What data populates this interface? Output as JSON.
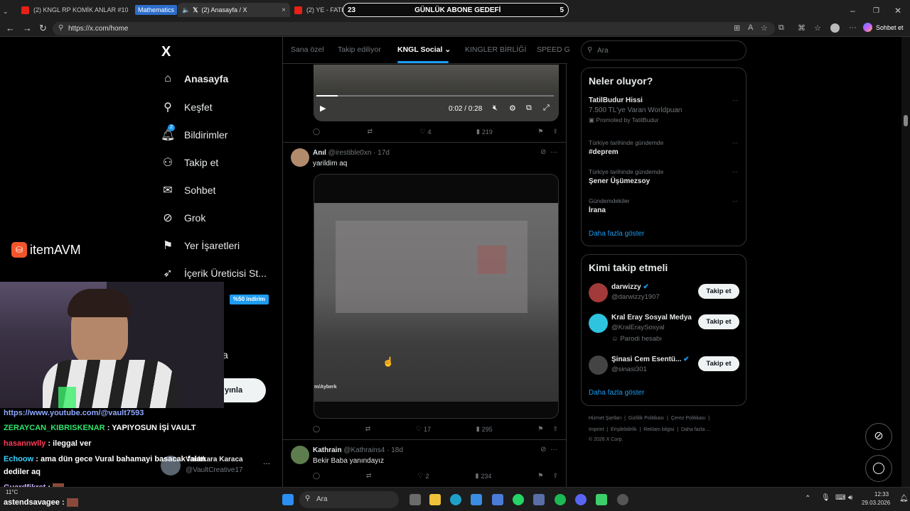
{
  "browser": {
    "tabs": [
      {
        "label": "(2) KNGL RP KOMİK ANLAR #10 -",
        "close": "×"
      },
      {
        "label": "Mathematics"
      },
      {
        "label": "(2) Anasayfa / X",
        "close": "×"
      },
      {
        "label": "(2) YE - FATHER"
      }
    ],
    "url": "https://x.com/home",
    "copilot_label": "Sohbet et"
  },
  "overlay_banner": {
    "left_count": "23",
    "title": "GÜNLÜK ABONE GEDEFİ",
    "right_count": "5"
  },
  "sidebar": {
    "logo": "X",
    "items": [
      {
        "label": "Anasayfa",
        "icon": "home-icon"
      },
      {
        "label": "Keşfet",
        "icon": "search-icon"
      },
      {
        "label": "Bildirimler",
        "icon": "bell-icon",
        "badge": "2"
      },
      {
        "label": "Takip et",
        "icon": "add-user-icon"
      },
      {
        "label": "Sohbet",
        "icon": "mail-icon"
      },
      {
        "label": "Grok",
        "icon": "grok-icon"
      },
      {
        "label": "Yer İşaretleri",
        "icon": "bookmark-icon"
      },
      {
        "label": "İçerik Üreticisi St...",
        "icon": "rocket-icon"
      }
    ],
    "premium_badge": "%50 indirim",
    "partial_more": "a",
    "post_button": "yınla",
    "account": {
      "name": "Vaultkara Karaca",
      "handle": "@VaultCreative17"
    }
  },
  "itemavm": {
    "brand": "itemAVM"
  },
  "feed": {
    "tabs": [
      "Sana özel",
      "Takip ediliyor",
      "KNGL Social",
      "KINGLER BİRLİĞİ",
      "SPEED G"
    ],
    "video_time": "0:02 / 0:28",
    "post0_actions": {
      "replies": "",
      "reposts": "",
      "likes": "4",
      "views": "219"
    },
    "posts": [
      {
        "name": "Anıl",
        "handle": "@irestible0xn",
        "time": "17d",
        "text": "yarildim aq",
        "watermark": "m/Ayberk",
        "likes": "17",
        "views": "295"
      },
      {
        "name": "Kathrain",
        "handle": "@Kathrains4",
        "time": "18d",
        "text": "Bekir Baba yanındayız",
        "likes": "2",
        "views": "234"
      }
    ]
  },
  "right": {
    "search_placeholder": "Ara",
    "trends_title": "Neler oluyor?",
    "trends": [
      {
        "context": "",
        "title": "TatilBudur Hissi",
        "sub": "7.500 TL'ye Varan Worldpuan",
        "promo": "Promoted by TatilBudur"
      },
      {
        "context": "Türkiye tarihinde gündemde",
        "title": "#deprem"
      },
      {
        "context": "Türkiye tarihinde gündemde",
        "title": "Şener Üşümezsoy"
      },
      {
        "context": "Gündemdekiler",
        "title": "İrana"
      }
    ],
    "show_more": "Daha fazla göster",
    "who_title": "Kimi takip etmeli",
    "who": [
      {
        "name": "darwizzy",
        "handle": "@darwizzy1907",
        "extra": ""
      },
      {
        "name": "Kral Eray Sosyal Medya",
        "handle": "@KralEraySosyal",
        "extra": "Parodi hesabı"
      },
      {
        "name": "Şinasi Cem Esentü...",
        "handle": "@sinasi301",
        "extra": ""
      }
    ],
    "follow_label": "Takip et",
    "footer": [
      "Hizmet Şartları",
      "Gizlilik Politikası",
      "Çerez Politikası",
      "Imprint",
      "Erişilebilirlik",
      "Reklam bilgisi",
      "Daha fazla ..."
    ],
    "copyright": "© 2026 X Corp."
  },
  "chat": {
    "lines": [
      {
        "user": "https://www.youtube.com/@vault7593",
        "msg": "",
        "color": "#8fa8ff"
      },
      {
        "user": "ZERAYCAN_KIBRISKENAR",
        "msg": ": YAPIYOSUN İŞİ VAULT",
        "color": "#2ee56b"
      },
      {
        "user": "hasannwlly",
        "msg": ": ileggal ver",
        "color": "#ff3a57"
      },
      {
        "user": "Echoow",
        "msg": ": ama dün gece Vural bahamayi basacak falan",
        "color": "#3ad0ff"
      },
      {
        "user": "",
        "msg": "dediler aq",
        "color": "#ffffff"
      },
      {
        "user": "Guardfikret",
        "msg": ":",
        "color": "#d0b0ff"
      },
      {
        "user": "astendsavagee",
        "msg": ":",
        "color": "#ffffff"
      }
    ]
  },
  "taskbar": {
    "search": "Ara",
    "temp": "11°C",
    "time": "12:33",
    "date": "29.03.2026"
  }
}
